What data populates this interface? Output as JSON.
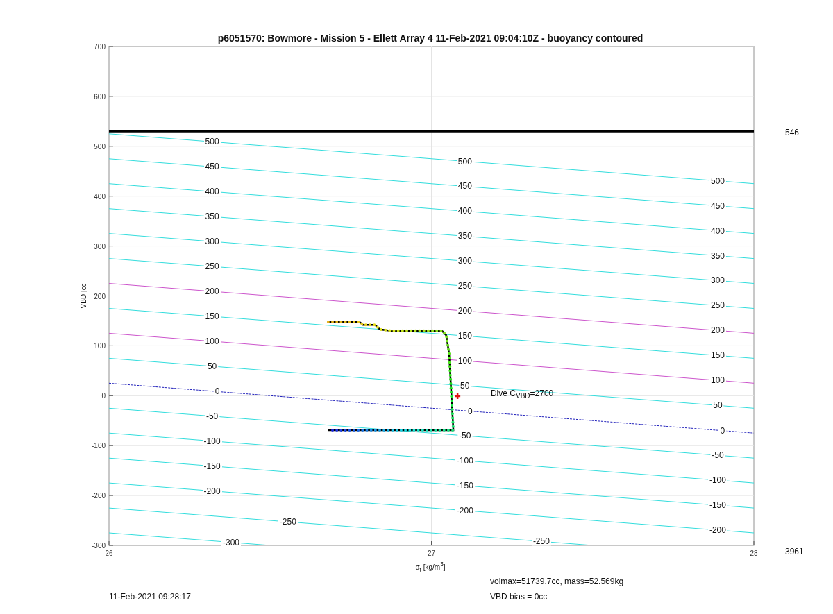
{
  "figure": {
    "chart_data": {
      "type": "line",
      "title": "p6051570: Bowmore - Mission 5 - Ellett Array 4 11-Feb-2021 09:04:10Z - buoyancy contoured",
      "xlabel": "σ$_{t}$ [kg/m$^{3}$]",
      "ylabel": "VBD [cc]",
      "x": [
        26,
        28
      ],
      "xlim": [
        26,
        28
      ],
      "ylim": [
        -300,
        700
      ],
      "xticks": [
        26,
        27,
        28
      ],
      "yticks": [
        -300,
        -200,
        -100,
        0,
        100,
        200,
        300,
        400,
        500,
        600,
        700
      ],
      "grid": true,
      "series": [
        {
          "color": "#33dddd",
          "values": [
            525,
            425
          ]
        },
        {
          "color": "#33dddd",
          "values": [
            475,
            375
          ]
        },
        {
          "color": "#33dddd",
          "values": [
            425,
            325
          ]
        },
        {
          "color": "#33dddd",
          "values": [
            375,
            275
          ]
        },
        {
          "color": "#33dddd",
          "values": [
            325,
            225
          ]
        },
        {
          "color": "#33dddd",
          "values": [
            275,
            175
          ]
        },
        {
          "color": "#cc55cc",
          "values": [
            225,
            125
          ]
        },
        {
          "color": "#33dddd",
          "values": [
            175,
            75
          ]
        },
        {
          "color": "#cc55cc",
          "values": [
            125,
            25
          ]
        },
        {
          "color": "#33dddd",
          "values": [
            75,
            -25
          ]
        },
        {
          "color": "#2222bb",
          "line_style": "dashed",
          "values": [
            25,
            -75
          ]
        },
        {
          "color": "#33dddd",
          "values": [
            -25,
            -125
          ]
        },
        {
          "color": "#33dddd",
          "values": [
            -75,
            -175
          ]
        },
        {
          "color": "#33dddd",
          "values": [
            -125,
            -225
          ]
        },
        {
          "color": "#33dddd",
          "values": [
            -175,
            -275
          ]
        },
        {
          "color": "#33dddd",
          "x": [
            26,
            27.5
          ],
          "values": [
            -225,
            -300
          ]
        },
        {
          "color": "#33dddd",
          "x": [
            26,
            26.5
          ],
          "values": [
            -275,
            -300
          ]
        },
        {
          "color": "#000000",
          "x": [
            26.68,
            26.777,
            26.788,
            26.825,
            26.84,
            26.874,
            27.033,
            27.046,
            27.055,
            27.068,
            26.68
          ],
          "values": [
            148,
            148,
            142,
            142,
            133,
            130,
            130,
            121,
            84,
            -69,
            -69
          ]
        }
      ],
      "ref_lines": [
        {
          "axis": "y",
          "value": 530,
          "color": "#000000"
        }
      ]
    },
    "contour_label_columns": [
      [
        "500",
        "450",
        "400",
        "350",
        "300",
        "250",
        "200",
        "150",
        "100",
        "50",
        "0",
        "-50",
        "-100",
        "-150",
        "-200",
        "-250",
        "-300"
      ],
      [
        "500",
        "450",
        "400",
        "350",
        "300",
        "250",
        "200",
        "150",
        "100",
        "50",
        "0",
        "-50",
        "-100",
        "-150",
        "-200",
        "-250"
      ],
      [
        "500",
        "450",
        "400",
        "350",
        "300",
        "250",
        "200",
        "150",
        "100",
        "50",
        "0",
        "-50",
        "-100",
        "-150",
        "-200"
      ]
    ],
    "dive_label": "Dive C$_{VBD}$=2700",
    "right_top_label": "546",
    "right_bottom_label": "3961",
    "volume_text": "volmax=51739.7cc, mass=52.569kg",
    "bias_text": "VBD bias = 0cc",
    "timestamp": "11-Feb-2021 09:28:17"
  }
}
